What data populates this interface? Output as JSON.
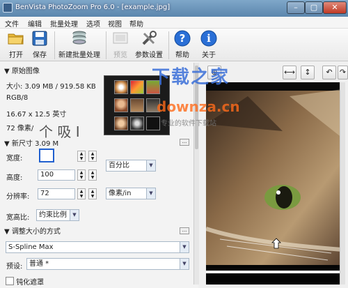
{
  "window": {
    "title": "BenVista PhotoZoom Pro 6.0 - [example.jpg]"
  },
  "menu": [
    "文件",
    "编辑",
    "批量处理",
    "选项",
    "视图",
    "帮助"
  ],
  "toolbar": {
    "open": "打开",
    "save": "保存",
    "batch": "新建批量处理",
    "preview": "预览",
    "settings": "参数设置",
    "help": "帮助",
    "about": "关于"
  },
  "original": {
    "header": "原始图像",
    "size": "大小: 3.09 MB / 919.58 KB",
    "mode": "RGB/8",
    "dimensions": "16.67 x 12.5 英寸",
    "resolution": "72 像素/"
  },
  "newsize": {
    "header": "新尺寸",
    "header_value": "3.09 M",
    "width_label": "宽度:",
    "height_label": "高度:",
    "height_value": "100",
    "resolution_label": "分辨率:",
    "resolution_value": "72",
    "unit_percent": "百分比",
    "unit_ppi": "像素/in",
    "aspect_label": "宽高比:",
    "aspect_value": "约束比例"
  },
  "resize": {
    "header": "调整大小的方式",
    "method": "S-Spline Max",
    "preset_label": "预设:",
    "preset_value": "普通 *",
    "unsharp_label": "钝化遮罩"
  },
  "watermarks": {
    "big": "下载之家",
    "url": "downza.cn",
    "sub": "专业的软件下载站",
    "left": "个 吸 I"
  },
  "colors": {
    "titlebar": "#6f97bf",
    "close": "#c03a25",
    "watermark_blue": "#3a6fd8",
    "watermark_orange": "#ff6b1a"
  }
}
